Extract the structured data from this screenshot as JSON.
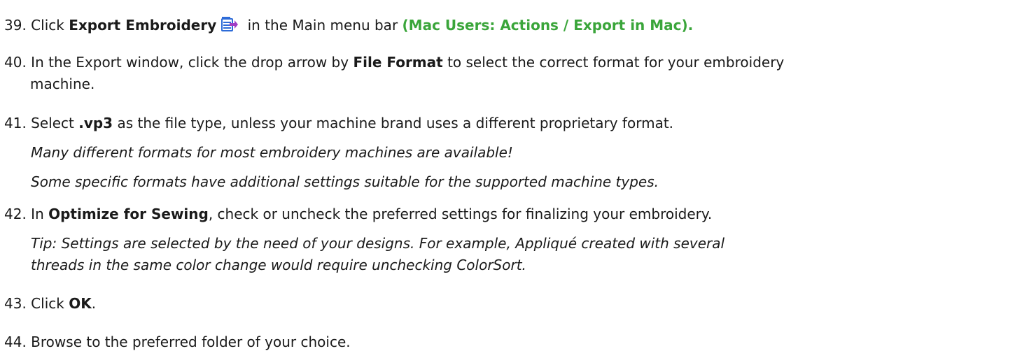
{
  "steps": {
    "s39": {
      "number": "39.",
      "pre": " Click ",
      "bold": "Export Embroidery",
      "post": " in the Main menu bar ",
      "mac_note": "(Mac Users: Actions / Export in Mac).",
      "icon": "export-embroidery-icon"
    },
    "s40": {
      "number": "40.",
      "pre": " In the Export window, click the drop arrow by ",
      "bold": "File Format",
      "post": " to select the correct format for your embroidery",
      "cont": "machine."
    },
    "s41": {
      "number": "41.",
      "pre": " Select ",
      "bold": ".vp3",
      "post": " as the file type, unless your machine brand uses a different proprietary format.",
      "note1": "Many different formats for most embroidery machines are available!",
      "note2": "Some specific formats have additional settings suitable for the supported machine types."
    },
    "s42": {
      "number": "42.",
      "pre": " In ",
      "bold": "Optimize for Sewing",
      "post": ", check or uncheck the preferred settings for finalizing your embroidery.",
      "tip1": "Tip:  Settings are selected by the need of your designs.  For example, Appliqué created with several",
      "tip2": "threads in the same color change would require unchecking ColorSort."
    },
    "s43": {
      "number": "43.",
      "pre": "  Click ",
      "bold": "OK",
      "post": "."
    },
    "s44": {
      "number": "44.",
      "text": " Browse to the preferred folder of your choice."
    }
  },
  "colors": {
    "mac_note": "#3aa53a",
    "icon_blue": "#2d6bd8",
    "icon_purple": "#a13cc4"
  }
}
